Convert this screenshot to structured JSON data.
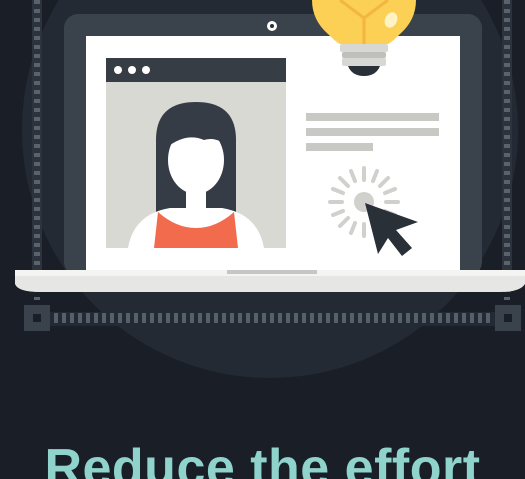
{
  "headline": {
    "text": "Reduce the effort"
  },
  "colors": {
    "background": "#1a1f27",
    "circle": "#232a33",
    "laptop_frame": "#3a424c",
    "screen": "#ffffff",
    "window_bar": "#363d45",
    "window_body": "#d9d9d4",
    "hair": "#353c45",
    "shirt": "#f26b4d",
    "text_lines": "#c8c8c4",
    "bulb": "#fccf55",
    "cursor": "#2a3038",
    "headline": "#8fd3cc"
  },
  "icons": {
    "lightbulb": "lightbulb-icon",
    "cursor": "cursor-icon",
    "user_avatar": "user-avatar",
    "click_burst": "click-burst-icon"
  }
}
